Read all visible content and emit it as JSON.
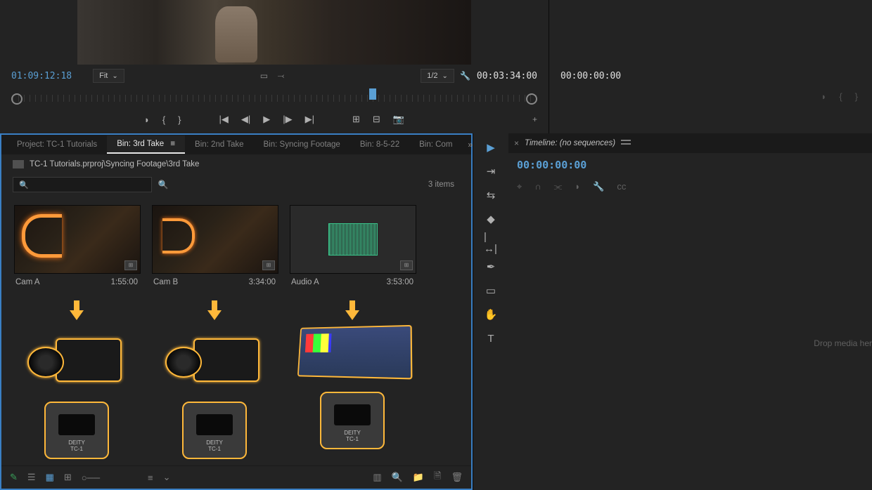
{
  "source_monitor": {
    "timecode_in": "01:09:12:18",
    "fit_label": "Fit",
    "res_label": "1/2",
    "duration": "00:03:34:00"
  },
  "program_monitor": {
    "timecode": "00:00:00:00"
  },
  "project": {
    "tabs": [
      {
        "label": "Project: TC-1 Tutorials",
        "active": false
      },
      {
        "label": "Bin: 3rd Take",
        "active": true
      },
      {
        "label": "Bin: 2nd Take",
        "active": false
      },
      {
        "label": "Bin: Syncing Footage",
        "active": false
      },
      {
        "label": "Bin: 8-5-22",
        "active": false
      },
      {
        "label": "Bin: Com",
        "active": false
      }
    ],
    "breadcrumb": "TC-1 Tutorials.prproj\\Syncing Footage\\3rd Take",
    "search_placeholder": "",
    "item_count": "3 items",
    "clips": [
      {
        "name": "Cam A",
        "duration": "1:55:00",
        "type": "video"
      },
      {
        "name": "Cam B",
        "duration": "3:34:00",
        "type": "video"
      },
      {
        "name": "Audio A",
        "duration": "3:53:00",
        "type": "audio"
      }
    ]
  },
  "timeline": {
    "title": "Timeline: (no sequences)",
    "timecode": "00:00:00:00",
    "drop_hint": "Drop media her"
  }
}
